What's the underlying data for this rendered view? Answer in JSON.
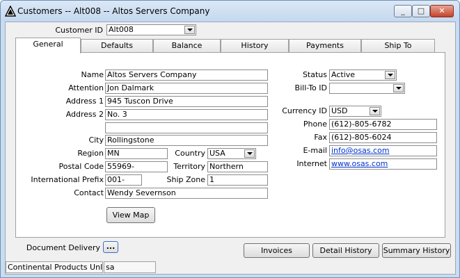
{
  "window": {
    "title": "Customers -- Alt008 -- Altos Servers Company",
    "minimize_glyph": "_",
    "maximize_glyph": "□",
    "close_glyph": "✕",
    "app_icon": "warning-triangle-icon"
  },
  "header": {
    "customer_id_label": "Customer ID",
    "customer_id_value": "Alt008"
  },
  "tabs": [
    {
      "label": "General"
    },
    {
      "label": "Defaults"
    },
    {
      "label": "Balance"
    },
    {
      "label": "History"
    },
    {
      "label": "Payments"
    },
    {
      "label": "Ship To"
    }
  ],
  "general": {
    "name_label": "Name",
    "name_value": "Altos Servers Company",
    "attention_label": "Attention",
    "attention_value": "Jon Dalmark",
    "address1_label": "Address 1",
    "address1_value": "945 Tuscon Drive",
    "address2_label": "Address 2",
    "address2_value": "No. 3",
    "address3_value": "",
    "city_label": "City",
    "city_value": "Rollingstone",
    "region_label": "Region",
    "region_value": "MN",
    "country_label": "Country",
    "country_value": "USA",
    "postal_label": "Postal Code",
    "postal_value": "55969-",
    "territory_label": "Territory",
    "territory_value": "Northern",
    "intl_prefix_label": "International Prefix",
    "intl_prefix_value": "001-",
    "ship_zone_label": "Ship Zone",
    "ship_zone_value": "1",
    "contact_label": "Contact",
    "contact_value": "Wendy Severnson",
    "view_map_label": "View Map",
    "status_label": "Status",
    "status_value": "Active",
    "bill_to_label": "Bill-To ID",
    "bill_to_value": "",
    "currency_label": "Currency ID",
    "currency_value": "USD",
    "phone_label": "Phone",
    "phone_value": "(612)-805-6782",
    "fax_label": "Fax",
    "fax_value": "(612)-805-6024",
    "email_label": "E-mail",
    "email_value": "info@osas.com",
    "internet_label": "Internet",
    "internet_value": "www.osas.com"
  },
  "footer": {
    "doc_delivery_label": "Document Delivery",
    "doc_delivery_button": "...",
    "invoices_label": "Invoices",
    "detail_history_label": "Detail History",
    "summary_history_label": "Summary History"
  },
  "status_bar": {
    "company": "Continental Products Unlimite",
    "user": "sa"
  }
}
